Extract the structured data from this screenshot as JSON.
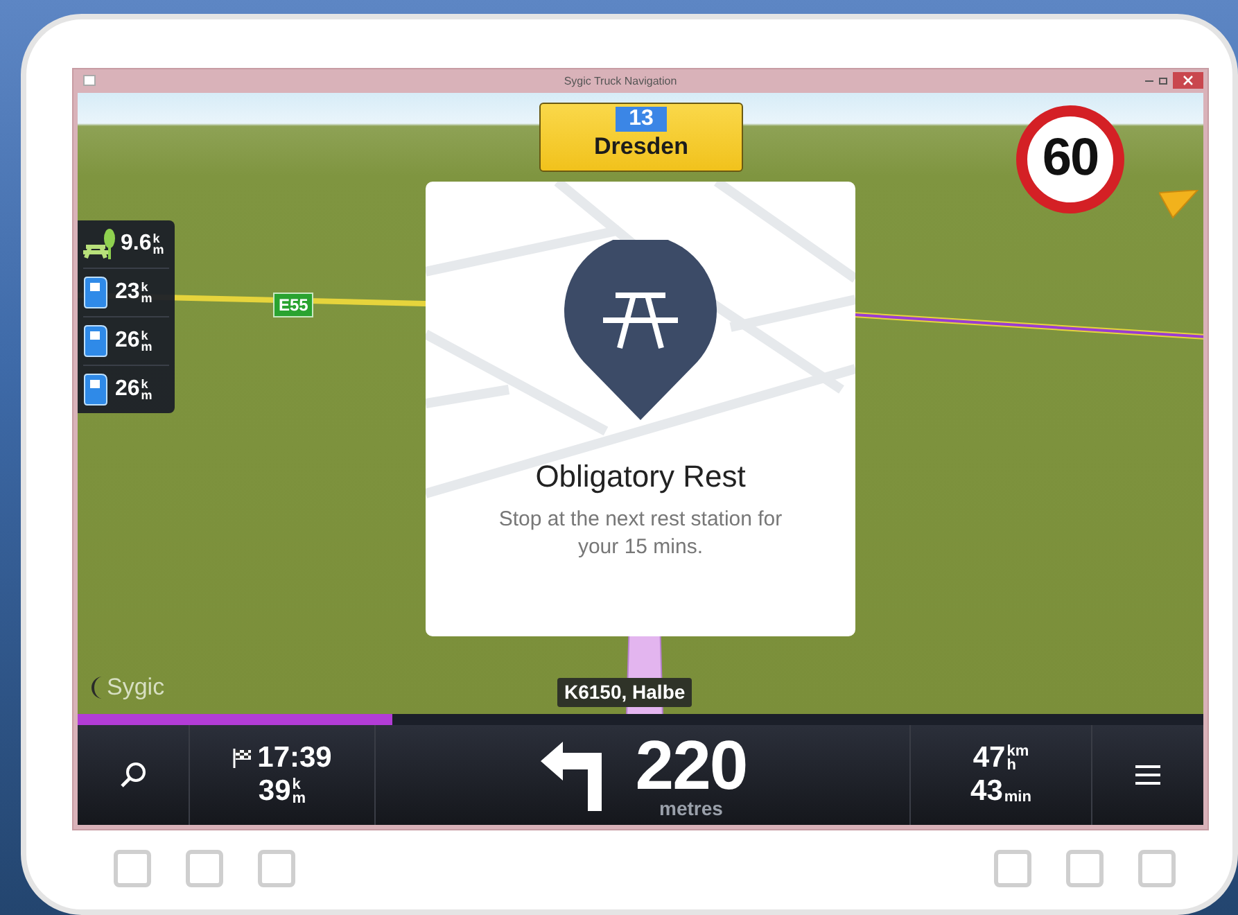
{
  "window": {
    "title": "Sygic Truck Navigation"
  },
  "map": {
    "route_sign": {
      "number": "13",
      "name": "Dresden"
    },
    "speed_limit": "60",
    "road_label": "E55",
    "street_label": "K6150, Halbe",
    "logo": "Sygic"
  },
  "poi_list": [
    {
      "kind": "rest",
      "value": "9.6",
      "unit_top": "k",
      "unit_bottom": "m"
    },
    {
      "kind": "fuel",
      "value": "23",
      "unit_top": "k",
      "unit_bottom": "m"
    },
    {
      "kind": "fuel",
      "value": "26",
      "unit_top": "k",
      "unit_bottom": "m"
    },
    {
      "kind": "fuel",
      "value": "26",
      "unit_top": "k",
      "unit_bottom": "m"
    }
  ],
  "dialog": {
    "title": "Obligatory Rest",
    "message": "Stop at the next rest station for your 15 mins."
  },
  "route_progress": {
    "level": 0.28
  },
  "bottom_bar": {
    "arrival_time": "17:39",
    "remaining_distance": {
      "value": "39",
      "unit_top": "k",
      "unit_bottom": "m"
    },
    "turn_distance": "220",
    "turn_unit": "metres",
    "speed": {
      "value": "47",
      "unit_top": "km",
      "unit_bottom": "h"
    },
    "remaining_time": {
      "value": "43",
      "unit": "min"
    }
  }
}
